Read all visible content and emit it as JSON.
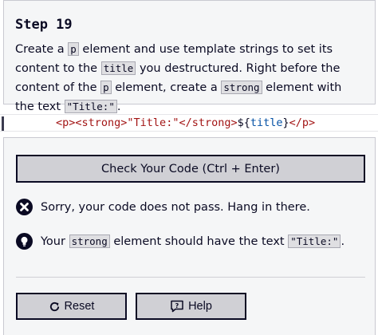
{
  "step": {
    "title": "Step 19",
    "desc": {
      "p1": "Create a ",
      "c1": "p",
      "p2": " element and use template strings to set its content to the ",
      "c2": "title",
      "p3": " you destructured. Right before the content of the ",
      "c3": "p",
      "p4": " element, create a ",
      "c4": "strong",
      "p5": " element with the text ",
      "c5": "\"Title:\"",
      "p6": "."
    }
  },
  "editor": {
    "tokens": {
      "t1": "<p>",
      "t2": "<strong>",
      "t3": "\"Title:\"",
      "t4": "</strong>",
      "t5": "${",
      "t6": "title",
      "t7": "}",
      "t8": "</p>"
    }
  },
  "actions": {
    "check_label": "Check Your Code (Ctrl + Enter)",
    "reset_label": "Reset",
    "help_label": "Help"
  },
  "feedback": {
    "fail_text": "Sorry, your code does not pass. Hang in there.",
    "hint": {
      "p1": "Your ",
      "c1": "strong",
      "p2": " element should have the text ",
      "c2": "\"Title:\"",
      "p3": "."
    }
  },
  "colors": {
    "panel_bg": "#f5f6f7",
    "button_bg": "#d0d0d5",
    "text": "#0a0a23",
    "tag": "#a31515",
    "variable": "#0451a5"
  }
}
